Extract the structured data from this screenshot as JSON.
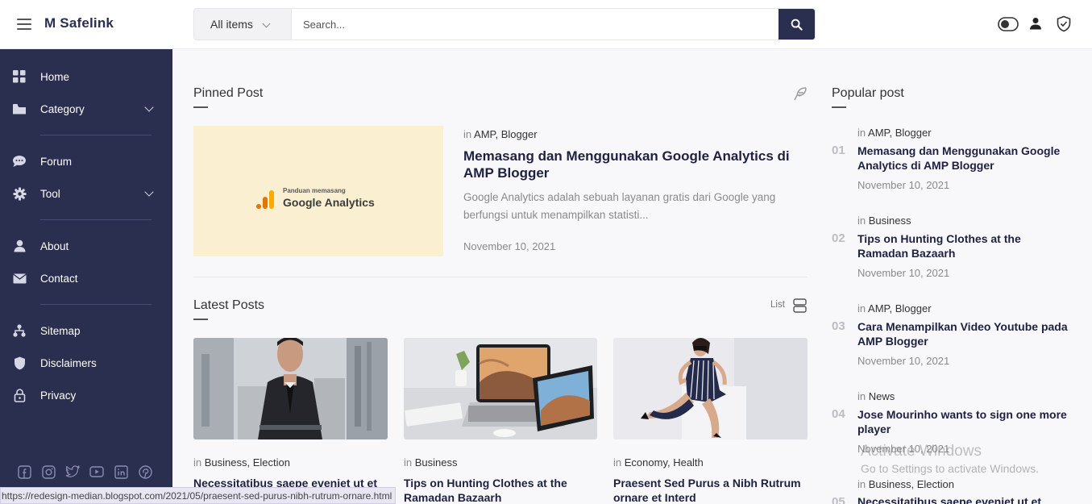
{
  "header": {
    "brand": "M Safelink",
    "search_category": "All items",
    "search_placeholder": "Search..."
  },
  "sidebar": {
    "items": [
      {
        "label": "Home",
        "icon": "grid-icon"
      },
      {
        "label": "Category",
        "icon": "folder-icon"
      },
      {
        "label": "Forum",
        "icon": "chat-icon"
      },
      {
        "label": "Tool",
        "icon": "gear-icon"
      },
      {
        "label": "About",
        "icon": "user-icon"
      },
      {
        "label": "Contact",
        "icon": "mail-icon"
      },
      {
        "label": "Sitemap",
        "icon": "sitemap-icon"
      },
      {
        "label": "Disclaimers",
        "icon": "shield-icon"
      },
      {
        "label": "Privacy",
        "icon": "lock-icon"
      }
    ],
    "socials": [
      "facebook-icon",
      "instagram-icon",
      "twitter-icon",
      "youtube-icon",
      "linkedin-icon",
      "pinterest-icon"
    ]
  },
  "pinned": {
    "title": "Pinned Post",
    "image_small": "Panduan memasang",
    "image_big": "Google Analytics",
    "meta_prefix": "in",
    "categories": "AMP, Blogger",
    "post_title": "Memasang dan Menggunakan Google Analytics di AMP Blogger",
    "excerpt": "Google Analytics adalah sebuah layanan gratis dari Google yang berfungsi untuk menampilkan statisti...",
    "date": "November 10, 2021"
  },
  "latest": {
    "title": "Latest Posts",
    "view_label": "List",
    "posts": [
      {
        "categories": "Business, Election",
        "title": "Necessitatibus saepe eveniet ut et"
      },
      {
        "categories": "Business",
        "title": "Tips on Hunting Clothes at the Ramadan Bazaarh"
      },
      {
        "categories": "Economy, Health",
        "title": "Praesent Sed Purus a Nibh Rutrum ornare et Interd"
      }
    ]
  },
  "popular": {
    "title": "Popular post",
    "posts": [
      {
        "num": "01",
        "categories": "AMP, Blogger",
        "title": "Memasang dan Menggunakan Google Analytics di AMP Blogger",
        "date": "November 10, 2021"
      },
      {
        "num": "02",
        "categories": "Business",
        "title": "Tips on Hunting Clothes at the Ramadan Bazaarh",
        "date": "November 10, 2021"
      },
      {
        "num": "03",
        "categories": "AMP, Blogger",
        "title": "Cara Menampilkan Video Youtube pada AMP Blogger",
        "date": "November 10, 2021"
      },
      {
        "num": "04",
        "categories": "News",
        "title": "Jose Mourinho wants to sign one more player",
        "date": "November 10, 2021"
      },
      {
        "num": "05",
        "categories": "Business, Election",
        "title": "Necessitatibus saepe eveniet ut et"
      }
    ]
  },
  "status_url": "https://redesign-median.blogspot.com/2021/05/praesent-sed-purus-nibh-rutrum-ornare.html",
  "watermark": {
    "line1": "Activate Windows",
    "line2": "Go to Settings to activate Windows."
  },
  "colors": {
    "sidebar": "#2a2e4f",
    "accent": "#2a2e4f",
    "ga_orange": "#f9ab00"
  }
}
